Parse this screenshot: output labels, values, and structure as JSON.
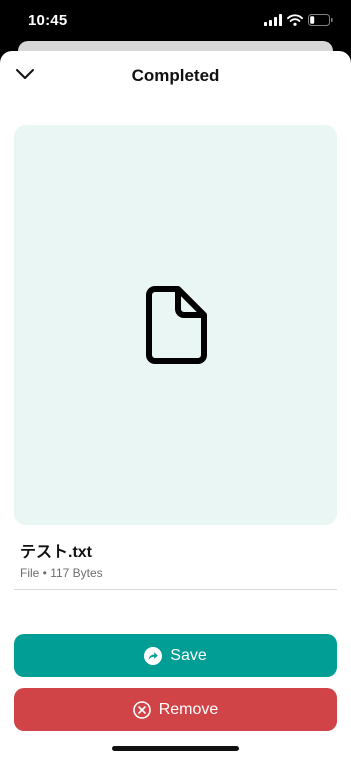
{
  "status_bar": {
    "time": "10:45"
  },
  "sheet": {
    "title": "Completed"
  },
  "file": {
    "name": "テスト.txt",
    "meta": "File • 117 Bytes",
    "icon": "document-icon"
  },
  "actions": {
    "save_label": "Save",
    "remove_label": "Remove"
  },
  "colors": {
    "preview_bg": "#eaf6f4",
    "save_bg": "#009e94",
    "remove_bg": "#d04448"
  }
}
